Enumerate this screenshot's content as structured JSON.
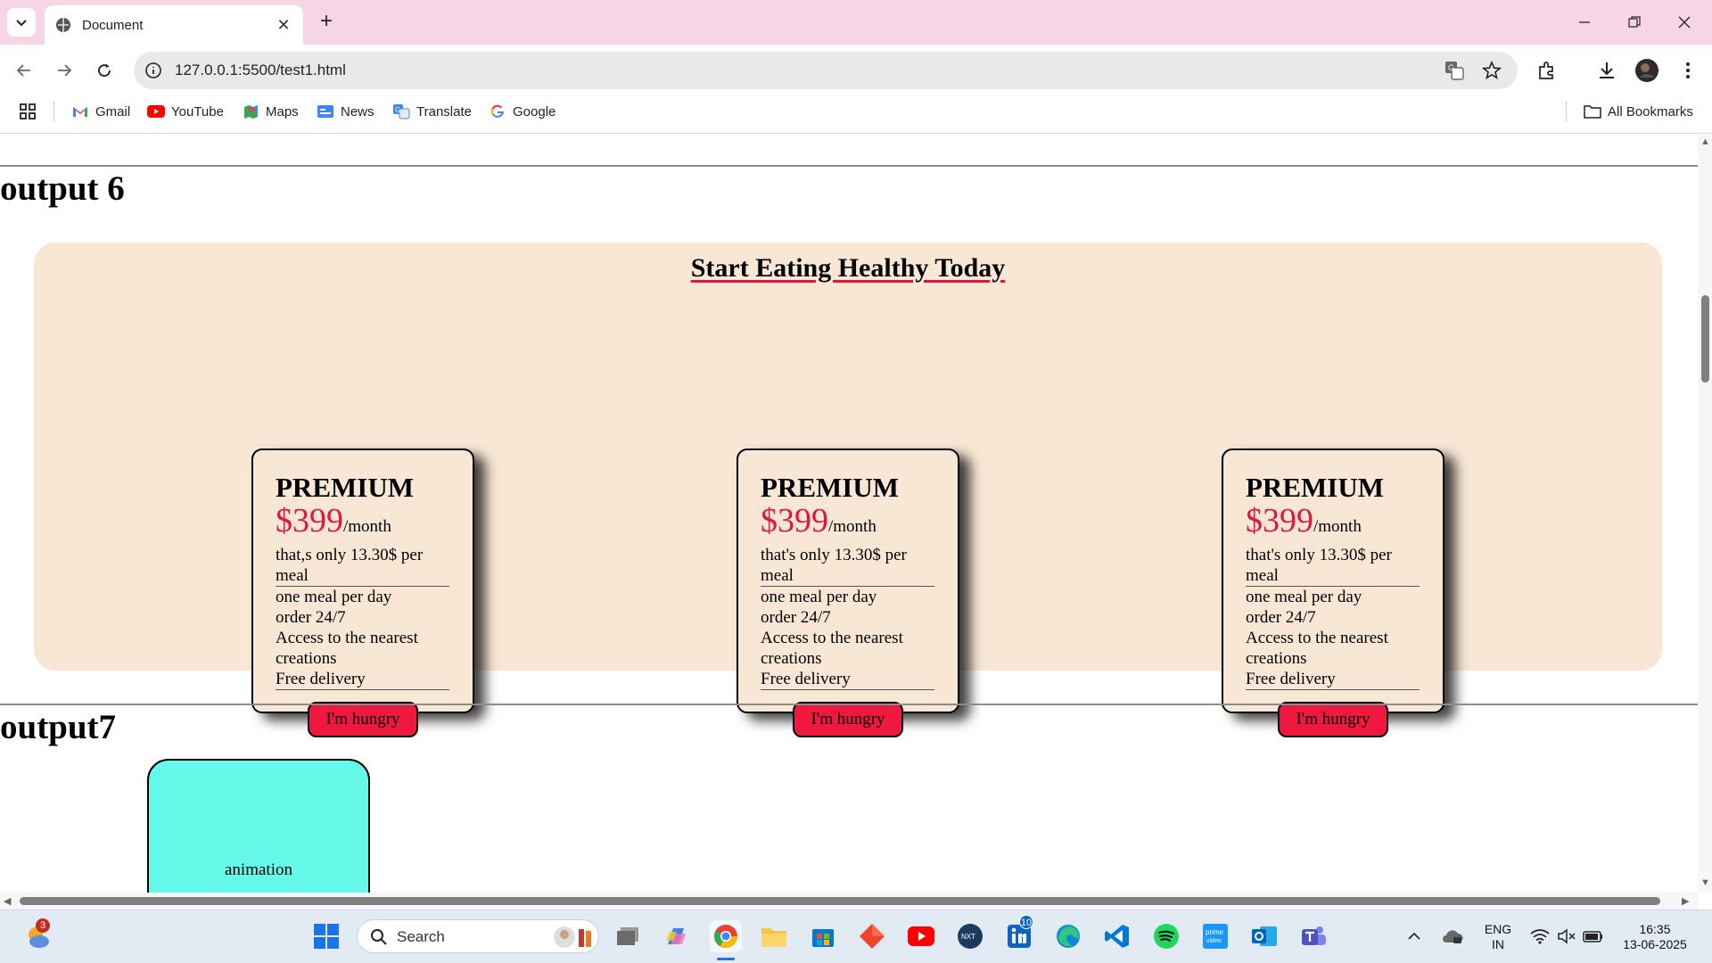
{
  "browser": {
    "tab_title": "Document",
    "url": "127.0.0.1:5500/test1.html",
    "bookmarks": [
      {
        "label": "Gmail",
        "icon": "gmail-icon"
      },
      {
        "label": "YouTube",
        "icon": "youtube-icon"
      },
      {
        "label": "Maps",
        "icon": "maps-icon"
      },
      {
        "label": "News",
        "icon": "news-icon"
      },
      {
        "label": "Translate",
        "icon": "translate-icon"
      },
      {
        "label": "Google",
        "icon": "google-icon"
      }
    ],
    "all_bookmarks": "All Bookmarks"
  },
  "page": {
    "section6_heading": "output 6",
    "panel_title": "Start Eating Healthy Today",
    "cards": [
      {
        "plan": "PREMIUM",
        "price": "$399",
        "period": "/month",
        "note": "that,s only 13.30$ per meal",
        "features": [
          "one meal per day",
          "order 24/7",
          "Access to the nearest creations",
          "Free delivery"
        ],
        "button": "I'm hungry"
      },
      {
        "plan": "PREMIUM",
        "price": "$399",
        "period": "/month",
        "note": "that's only 13.30$ per meal",
        "features": [
          "one meal per day",
          "order 24/7",
          "Access to the nearest creations",
          "Free delivery"
        ],
        "button": "I'm hungry"
      },
      {
        "plan": "PREMIUM",
        "price": "$399",
        "period": "/month",
        "note": "that's only 13.30$ per meal",
        "features": [
          "one meal per day",
          "order 24/7",
          "Access to the nearest creations",
          "Free delivery"
        ],
        "button": "I'm hungry"
      }
    ],
    "section7_heading": "output7",
    "animation_label": "animation"
  },
  "taskbar": {
    "search_label": "Search",
    "weather_badge": "3",
    "linkedin_badge": "10",
    "lang": "ENG",
    "region": "IN",
    "time": "16:35",
    "date": "13-06-2025"
  },
  "colors": {
    "tabbar": "#f6d6e6",
    "panel_bg": "#f8e7d5",
    "price_red": "#e0183f",
    "button_red": "#f0183f",
    "animation_box": "#64f9e9"
  }
}
